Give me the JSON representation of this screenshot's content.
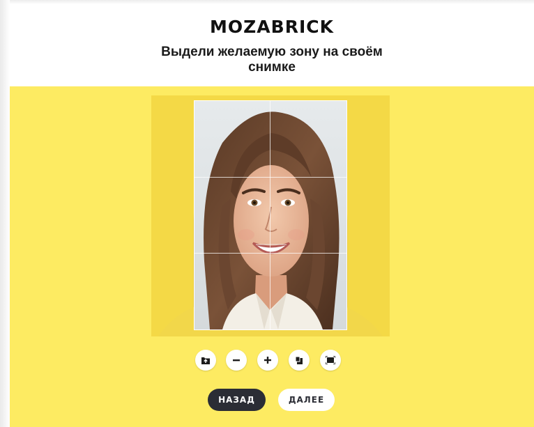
{
  "header": {
    "logo_text": "MOZABRICK",
    "title": "Выдели желаемую зону на своём снимке"
  },
  "editor": {
    "crop_grid": "3x3",
    "photo_description_icon": "portrait-photo"
  },
  "toolbar": {
    "buttons": [
      {
        "name": "upload-photo",
        "icon": "folder-upload-icon"
      },
      {
        "name": "zoom-out",
        "icon": "minus-icon"
      },
      {
        "name": "zoom-in",
        "icon": "plus-icon"
      },
      {
        "name": "rotate",
        "icon": "rotate-icon"
      },
      {
        "name": "fit",
        "icon": "frame-fit-icon"
      }
    ]
  },
  "navigation": {
    "back_label": "НАЗАД",
    "next_label": "ДАЛЕЕ"
  },
  "colors": {
    "workspace_bg": "#fdeb62",
    "canvas_bg": "#f6dd45",
    "back_button_bg": "#2b2d35",
    "next_button_bg": "#ffffff"
  }
}
